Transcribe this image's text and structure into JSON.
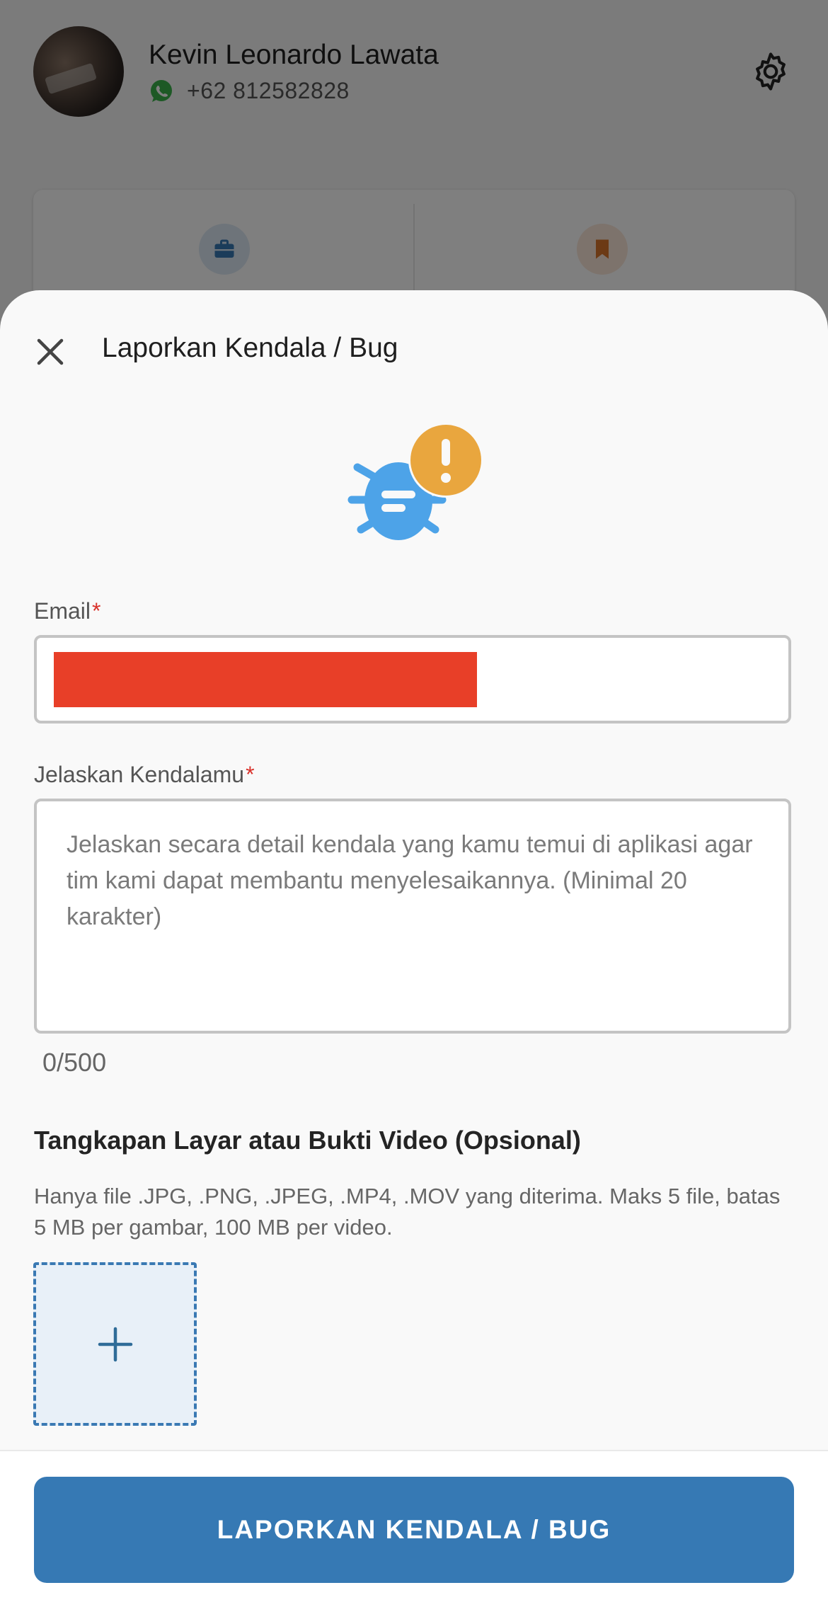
{
  "profile": {
    "name": "Kevin Leonardo Lawata",
    "phone": "+62 812582828",
    "icons": {
      "whatsapp": "whatsapp-icon",
      "settings": "gear-icon",
      "jobs": "briefcase-icon",
      "saved": "bookmark-icon"
    }
  },
  "sheet": {
    "title": "Laporkan Kendala / Bug",
    "illustration": "bug-alert-icon",
    "email": {
      "label": "Email",
      "required_mark": "*"
    },
    "description": {
      "label": "Jelaskan Kendalamu",
      "required_mark": "*",
      "placeholder": "Jelaskan secara detail kendala yang kamu temui di aplikasi agar tim kami dapat membantu menyelesaikannya. (Minimal 20 karakter)",
      "counter": "0/500"
    },
    "upload": {
      "title": "Tangkapan Layar atau Bukti Video (Opsional)",
      "hint": "Hanya file .JPG, .PNG, .JPEG, .MP4, .MOV yang diterima. Maks 5 file, batas 5 MB per gambar, 100 MB per video."
    },
    "submit_label": "LAPORKAN KENDALA / BUG"
  },
  "colors": {
    "primary": "#3679b4",
    "bug_blue": "#4da3e8",
    "alert_orange": "#e9a63e",
    "required_red": "#d9322b",
    "redaction": "#e83f28"
  }
}
